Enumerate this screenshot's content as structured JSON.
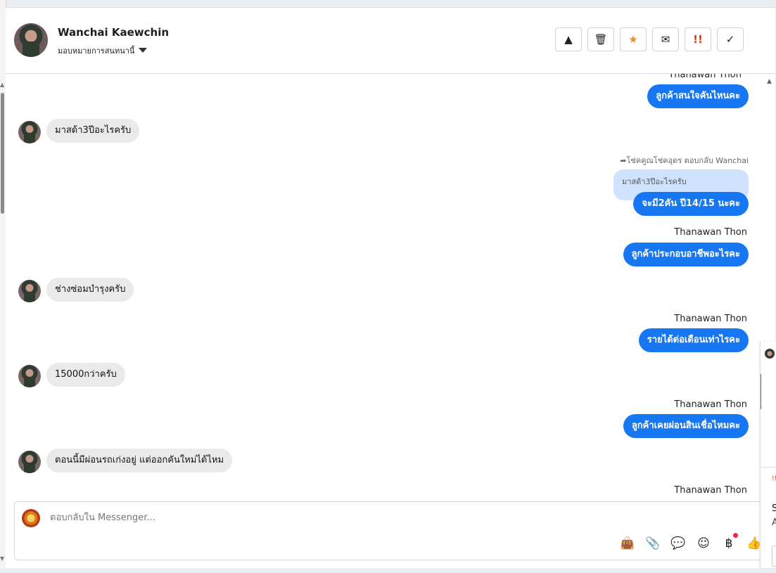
{
  "header": {
    "name": "Wanchai Kaewchin",
    "assign_label": "มอบหมายการสนทนานี้"
  },
  "toolbar": {
    "buttons": [
      {
        "icon": "warning-icon",
        "glyph": "▲"
      },
      {
        "icon": "trash-icon",
        "glyph": "🗑"
      },
      {
        "icon": "star-icon",
        "glyph": "★"
      },
      {
        "icon": "envelope-open-icon",
        "glyph": "✉"
      },
      {
        "icon": "urgent-icon",
        "glyph": "!!"
      },
      {
        "icon": "check-icon",
        "glyph": "✓"
      }
    ]
  },
  "messages": {
    "top_sender_partial": "Thanawan Thon",
    "out1": "ลูกค้าสนใจคันไหนคะ",
    "in1": "มาสด้า3ปีอะไรครับ",
    "reply_meta": "โช่คคูณโช่คอุดร ตอบกลับ Wanchai",
    "quoted": "มาสด้า3ปีอะไรครับ",
    "out2": "จะมี2คัน ปี14/15 นะคะ",
    "sender2": "Thanawan Thon",
    "out3": "ลูกค้าประกอบอาชีพอะไรคะ",
    "in2": "ช่างซ่อมบำรุงครับ",
    "sender3": "Thanawan Thon",
    "out4": "รายได้ต่อเดือนเท่าไรคะ",
    "in3": "15000กว่าครับ",
    "sender4": "Thanawan Thon",
    "out5": "ลูกค้าเคยผ่อนสินเชื่อไหมคะ",
    "in4": "ตอนนี้มีผ่อนรถเก่งอยู่ แต่ออกคันใหม่ได้ไหม",
    "sender5": "Thanawan Thon"
  },
  "composer": {
    "placeholder": "ตอบกลับใน Messenger..."
  },
  "side_panel": {
    "line1": "S",
    "line2": "A"
  },
  "colors": {
    "outgoing": "#1777f2",
    "incoming": "#eaeaea",
    "quoted": "#cfe3ff"
  }
}
